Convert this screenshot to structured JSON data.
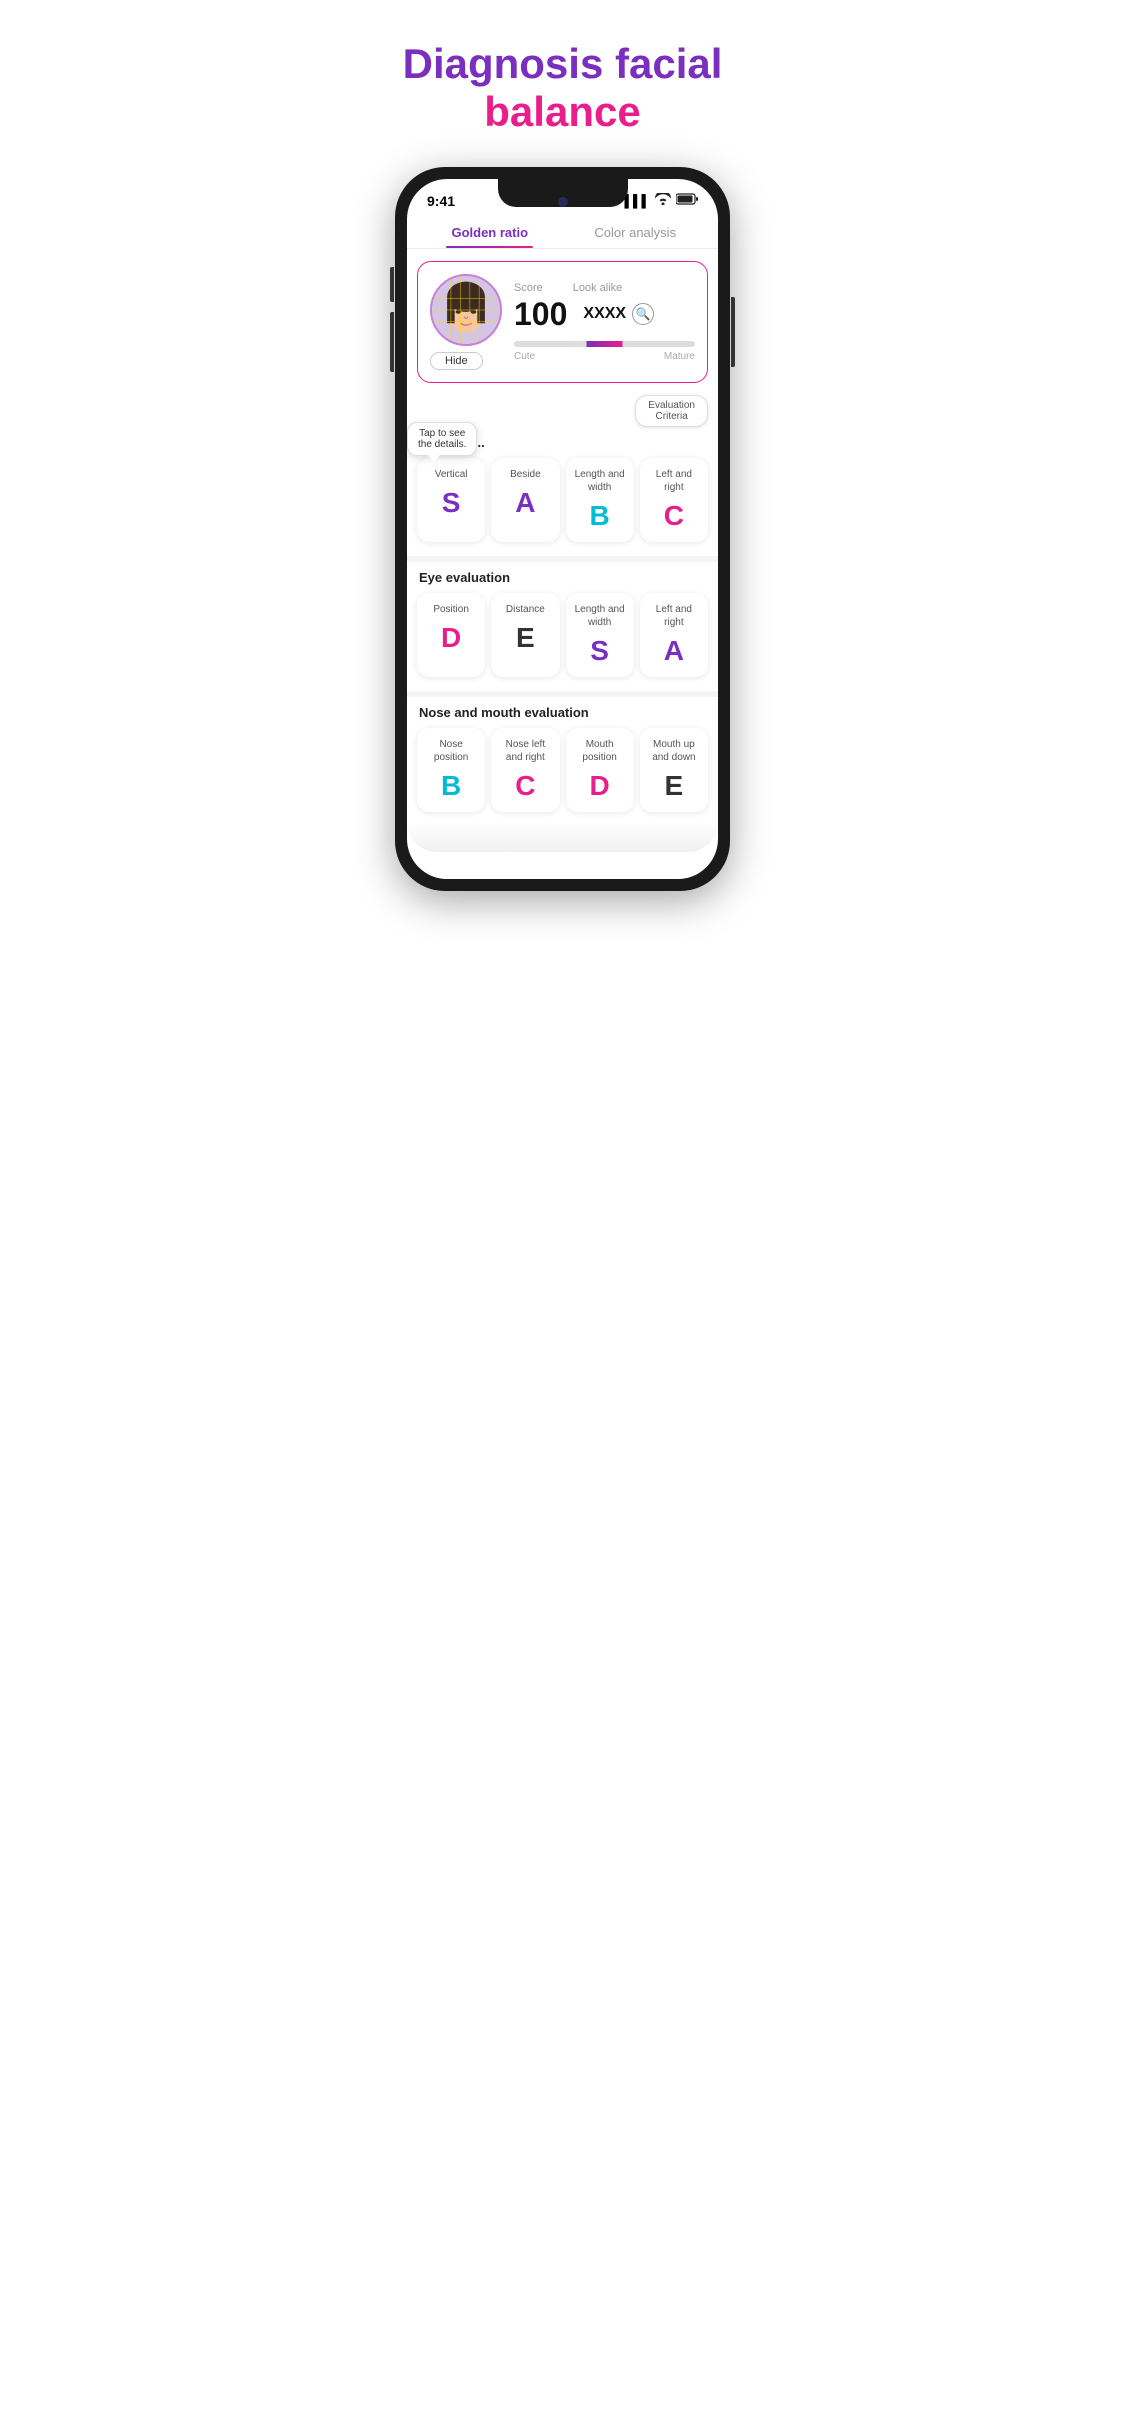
{
  "header": {
    "title_part1": "Diagnosis facial",
    "title_part2": "balance"
  },
  "tabs": [
    {
      "id": "golden-ratio",
      "label": "Golden ratio",
      "active": true
    },
    {
      "id": "color-analysis",
      "label": "Color analysis",
      "active": false
    }
  ],
  "status_bar": {
    "time": "9:41",
    "signal": "▌▌▌",
    "wifi": "wifi",
    "battery": "battery"
  },
  "score_card": {
    "score_label": "Score",
    "look_alike_label": "Look alike",
    "score_value": "100",
    "look_alike_value": "XXXX",
    "hide_button": "Hide",
    "gauge_left_label": "Cute",
    "gauge_right_label": "Mature",
    "eval_criteria_btn": "Evaluation\nCriteria",
    "tooltip": "Tap to see\nthe details."
  },
  "face_evaluation": {
    "section_label": "Face eva...",
    "cards": [
      {
        "label": "Vertical",
        "grade": "S",
        "grade_class": "grade-s"
      },
      {
        "label": "Beside",
        "grade": "A",
        "grade_class": "grade-a"
      },
      {
        "label": "Length and\nwidth",
        "grade": "B",
        "grade_class": "grade-b"
      },
      {
        "label": "Left and\nright",
        "grade": "C",
        "grade_class": "grade-c"
      }
    ]
  },
  "eye_evaluation": {
    "section_label": "Eye evaluation",
    "cards": [
      {
        "label": "Position",
        "grade": "D",
        "grade_class": "grade-d"
      },
      {
        "label": "Distance",
        "grade": "E",
        "grade_class": "grade-e"
      },
      {
        "label": "Length and\nwidth",
        "grade": "S",
        "grade_class": "grade-s"
      },
      {
        "label": "Left and\nright",
        "grade": "A",
        "grade_class": "grade-a"
      }
    ]
  },
  "nose_mouth_evaluation": {
    "section_label": "Nose and mouth evaluation",
    "cards": [
      {
        "label": "Nose\nposition",
        "grade": "B",
        "grade_class": "grade-b"
      },
      {
        "label": "Nose left\nand right",
        "grade": "C",
        "grade_class": "grade-c"
      },
      {
        "label": "Mouth\nposition",
        "grade": "D",
        "grade_class": "grade-d"
      },
      {
        "label": "Mouth up\nand down",
        "grade": "E",
        "grade_class": "grade-e"
      }
    ]
  }
}
